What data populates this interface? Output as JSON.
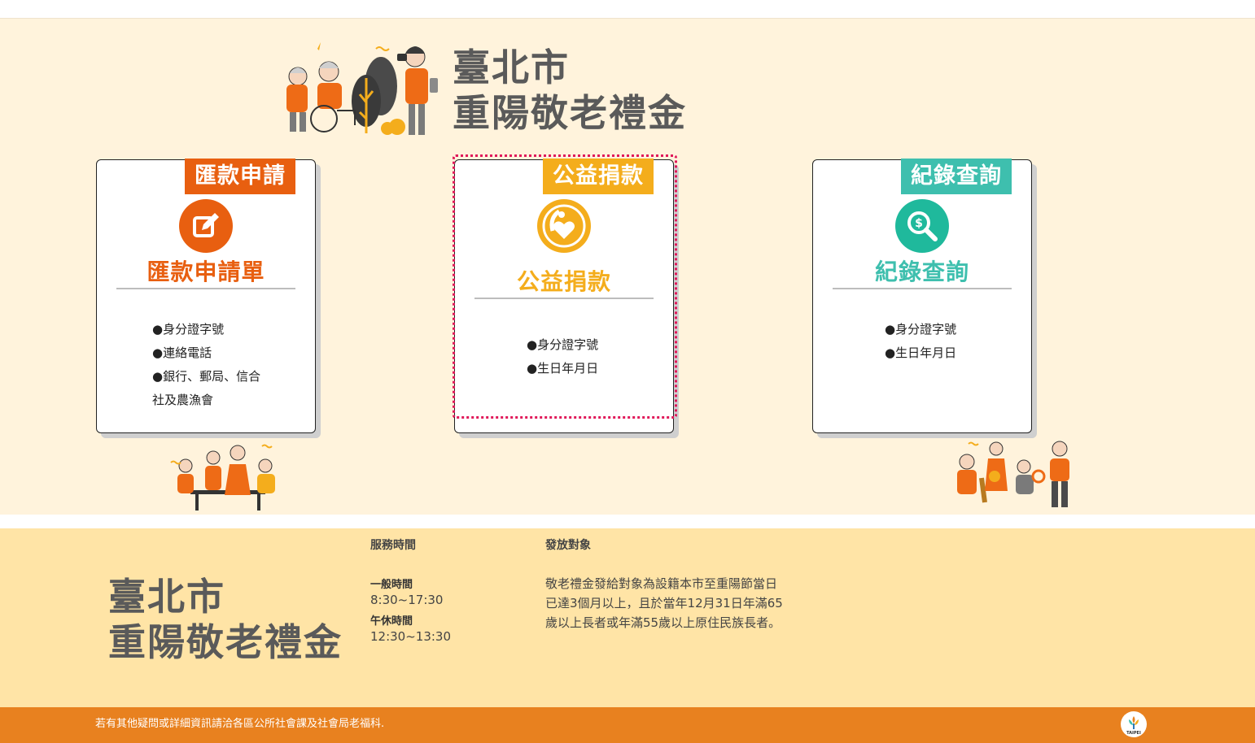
{
  "site": {
    "title_line1": "臺北市",
    "title_line2": "重陽敬老禮金"
  },
  "cards": [
    {
      "tag": "匯款申請",
      "heading": "匯款申請單",
      "icon": "pencil-edit-icon",
      "items": [
        "●身分證字號",
        "●連絡電話",
        "●銀行、郵局、信合社及農漁會"
      ]
    },
    {
      "tag": "公益捐款",
      "heading": "公益捐款",
      "icon": "heart-donation-icon",
      "items": [
        "●身分證字號",
        "●生日年月日"
      ]
    },
    {
      "tag": "紀錄查詢",
      "heading": "紀錄查詢",
      "icon": "money-search-icon",
      "items": [
        "●身分證字號",
        "●生日年月日"
      ]
    }
  ],
  "info": {
    "title_line1": "臺北市",
    "title_line2": "重陽敬老禮金",
    "service": {
      "heading": "服務時間",
      "regular_label": "一般時間",
      "regular_value": "8:30~17:30",
      "break_label": "午休時間",
      "break_value": "12:30~13:30"
    },
    "target": {
      "heading": "發放對象",
      "body": "敬老禮金發給對象為設籍本市至重陽節當日已達3個月以上，且於當年12月31日年滿65歲以上長者或年滿55歲以上原住民族長者。"
    }
  },
  "footer": {
    "text": "若有其他疑問或詳細資訊請洽各區公所社會課及社會局老福科.",
    "logo_text": "TAIPEI"
  },
  "colors": {
    "hero_bg": "#fff3dc",
    "info_bg": "#ffe4a6",
    "footer_bg": "#e8811f",
    "orange": "#e85f10",
    "yellow": "#f4ad1c",
    "teal": "#3ebfae",
    "focus": "#e0195a"
  }
}
